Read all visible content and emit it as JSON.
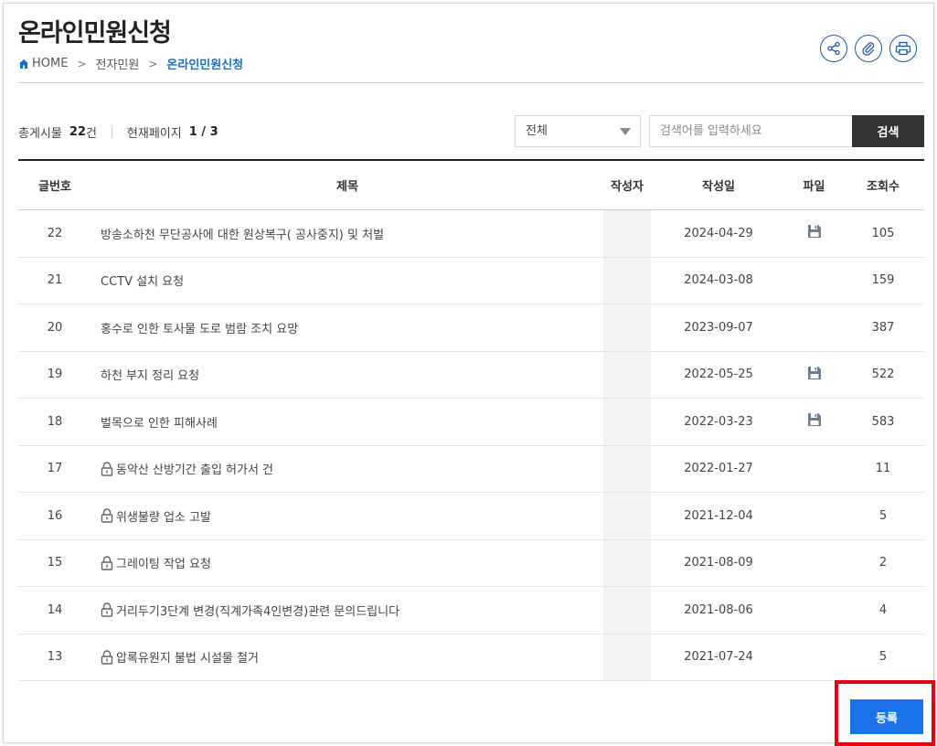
{
  "header": {
    "title": "온라인민원신청",
    "breadcrumb": [
      "HOME",
      "전자민원",
      "온라인민원신청"
    ]
  },
  "tools": [
    "share-icon",
    "attach-icon",
    "print-icon"
  ],
  "summary": {
    "total_label": "총게시물",
    "total_count": "22",
    "total_unit": "건",
    "page_label": "현재페이지",
    "page_value": "1 / 3"
  },
  "search": {
    "category": "전체",
    "placeholder": "검색어를 입력하세요",
    "button": "검색"
  },
  "table": {
    "headers": {
      "num": "글번호",
      "title": "제목",
      "author": "작성자",
      "date": "작성일",
      "file": "파일",
      "views": "조회수"
    },
    "rows": [
      {
        "num": "22",
        "title": "방송소하천 무단공사에 대한 원상복구( 공사중지) 및 처벌",
        "date": "2024-04-29",
        "views": "105",
        "file": true,
        "locked": false
      },
      {
        "num": "21",
        "title": "CCTV 설치 요청",
        "date": "2024-03-08",
        "views": "159",
        "file": false,
        "locked": false
      },
      {
        "num": "20",
        "title": "홍수로 인한 토사물 도로 범람 조치 요망",
        "date": "2023-09-07",
        "views": "387",
        "file": false,
        "locked": false
      },
      {
        "num": "19",
        "title": "하천 부지 정리 요청",
        "date": "2022-05-25",
        "views": "522",
        "file": true,
        "locked": false
      },
      {
        "num": "18",
        "title": "벌목으로 인한 피해사례",
        "date": "2022-03-23",
        "views": "583",
        "file": true,
        "locked": false
      },
      {
        "num": "17",
        "title": "동악산 산방기간 출입 허가서 건",
        "date": "2022-01-27",
        "views": "11",
        "file": false,
        "locked": true
      },
      {
        "num": "16",
        "title": "위생불량 업소 고발",
        "date": "2021-12-04",
        "views": "5",
        "file": false,
        "locked": true
      },
      {
        "num": "15",
        "title": "그레이팅 작업 요청",
        "date": "2021-08-09",
        "views": "2",
        "file": false,
        "locked": true
      },
      {
        "num": "14",
        "title": "거리두기3단계 변경(직계가족4인변경)관련 문의드립니다",
        "date": "2021-08-06",
        "views": "4",
        "file": false,
        "locked": true
      },
      {
        "num": "13",
        "title": "압록유원지 불법 시설물 철거",
        "date": "2021-07-24",
        "views": "5",
        "file": false,
        "locked": true
      }
    ]
  },
  "actions": {
    "register": "등록"
  },
  "colors": {
    "accent": "#1a73e8",
    "breadcrumb_current": "#1a6fc4",
    "search_button": "#333333",
    "highlight": "#e60012"
  }
}
